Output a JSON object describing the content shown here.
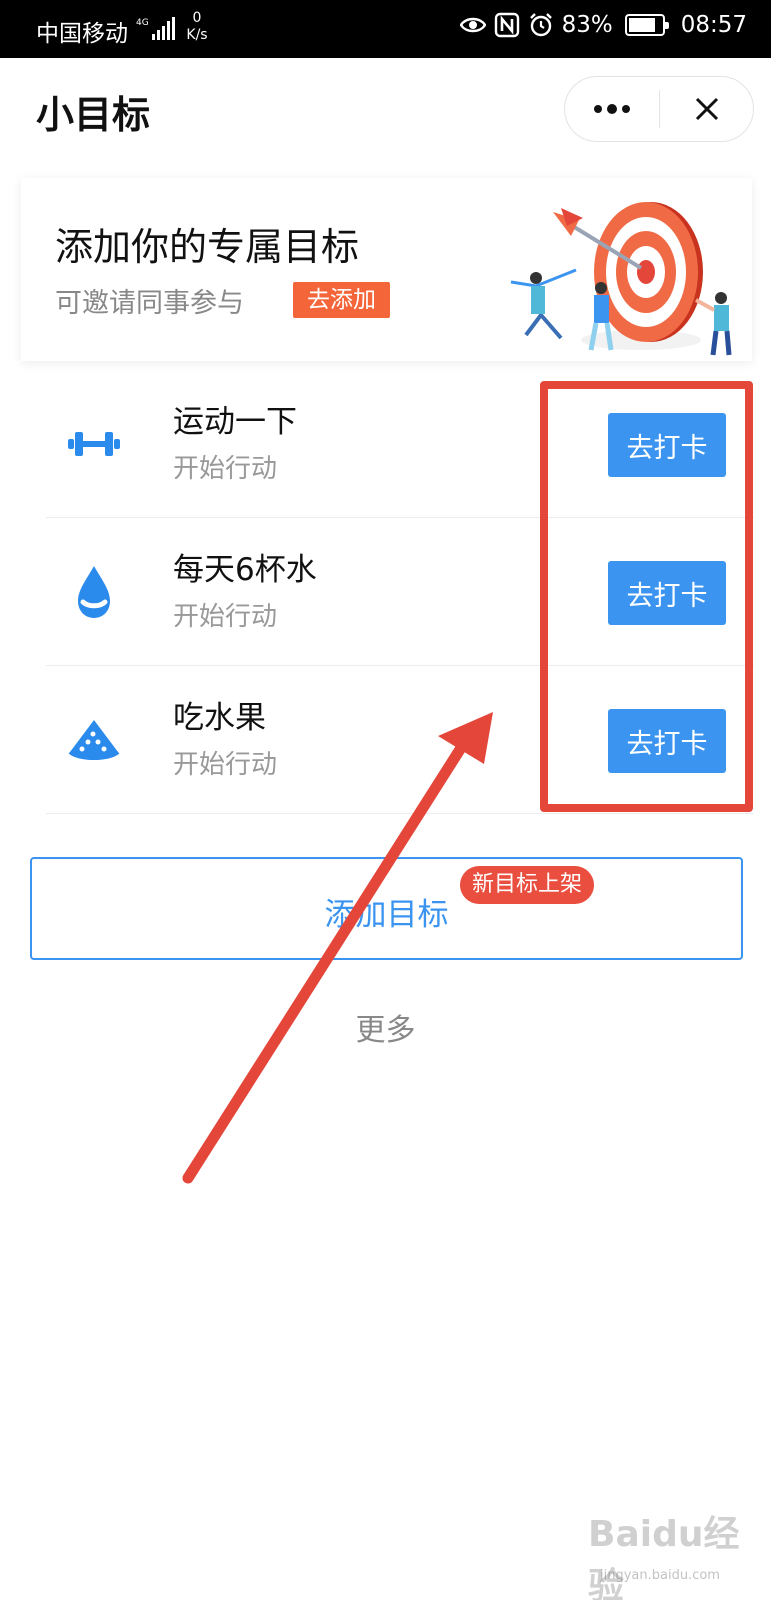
{
  "status_bar": {
    "carrier": "中国移动",
    "network": "4G",
    "net_speed_value": "0",
    "net_speed_unit": "K/s",
    "battery_percent": "83%",
    "battery_level": 0.83,
    "time": "08:57",
    "icons": [
      "eye-icon",
      "nfc-icon",
      "alarm-icon"
    ]
  },
  "header": {
    "title": "小目标"
  },
  "banner": {
    "title": "添加你的专属目标",
    "subtitle": "可邀请同事参与",
    "add_button": "去添加"
  },
  "goals": [
    {
      "title": "运动一下",
      "subtitle": "开始行动",
      "icon": "dumbbell-icon",
      "button": "去打卡"
    },
    {
      "title": "每天6杯水",
      "subtitle": "开始行动",
      "icon": "water-drop-icon",
      "button": "去打卡"
    },
    {
      "title": "吃水果",
      "subtitle": "开始行动",
      "icon": "watermelon-icon",
      "button": "去打卡"
    }
  ],
  "add_goal": {
    "label": "添加目标",
    "badge": "新目标上架"
  },
  "more": "更多",
  "watermark": {
    "text": "Baidu经验",
    "sub": "jingyan.baidu.com"
  },
  "colors": {
    "accent": "#3b95f0",
    "tag_orange": "#f4663a",
    "badge_red": "#ea4e3f",
    "annotation_red": "#e5463a"
  }
}
